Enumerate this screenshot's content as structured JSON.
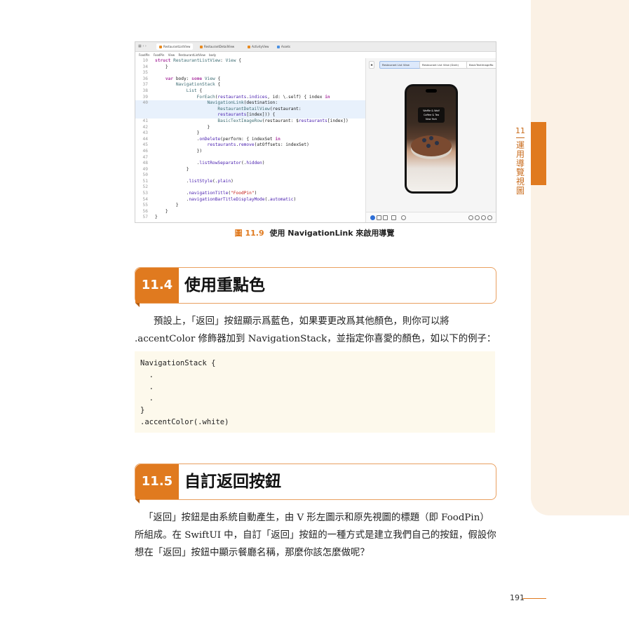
{
  "chapter": {
    "number": "11",
    "title": "運用導覽視圖"
  },
  "screenshot": {
    "tabs": [
      "RestaurantListView",
      "RestaurantDetailView",
      "ActivityView",
      "Assets"
    ],
    "breadcrumbs": [
      "FoodPin",
      "FoodPin",
      "View",
      "RestaurantListView",
      "body"
    ],
    "code_lines": [
      {
        "n": "10",
        "text": "struct RestaurantListView: View {",
        "hl": false
      },
      {
        "n": "34",
        "text": "    }",
        "hl": false
      },
      {
        "n": "35",
        "text": "",
        "hl": false
      },
      {
        "n": "36",
        "text": "    var body: some View {",
        "hl": false
      },
      {
        "n": "37",
        "text": "        NavigationStack {",
        "hl": false
      },
      {
        "n": "38",
        "text": "            List {",
        "hl": false
      },
      {
        "n": "39",
        "text": "                ForEach(restaurants.indices, id: \\.self) { index in",
        "hl": false
      },
      {
        "n": "40",
        "text": "                    NavigationLink(destination:",
        "hl": true
      },
      {
        "n": "",
        "text": "                        RestaurantDetailView(restaurant:",
        "hl": true
      },
      {
        "n": "",
        "text": "                        restaurants[index])) {",
        "hl": true
      },
      {
        "n": "41",
        "text": "                        BasicTextImageRow(restaurant: $restaurants[index])",
        "hl": false
      },
      {
        "n": "42",
        "text": "                    }",
        "hl": false
      },
      {
        "n": "43",
        "text": "                }",
        "hl": false
      },
      {
        "n": "44",
        "text": "                .onDelete(perform: { indexSet in",
        "hl": false
      },
      {
        "n": "45",
        "text": "                    restaurants.remove(atOffsets: indexSet)",
        "hl": false
      },
      {
        "n": "46",
        "text": "                })",
        "hl": false
      },
      {
        "n": "47",
        "text": "",
        "hl": false
      },
      {
        "n": "48",
        "text": "                .listRowSeparator(.hidden)",
        "hl": false
      },
      {
        "n": "49",
        "text": "            }",
        "hl": false
      },
      {
        "n": "50",
        "text": "",
        "hl": false
      },
      {
        "n": "51",
        "text": "            .listStyle(.plain)",
        "hl": false
      },
      {
        "n": "52",
        "text": "",
        "hl": false
      },
      {
        "n": "53",
        "text": "            .navigationTitle(\"FoodPin\")",
        "hl": false
      },
      {
        "n": "54",
        "text": "            .navigationBarTitleDisplayMode(.automatic)",
        "hl": false
      },
      {
        "n": "55",
        "text": "        }",
        "hl": false
      },
      {
        "n": "56",
        "text": "    }",
        "hl": false
      },
      {
        "n": "57",
        "text": "}",
        "hl": false
      }
    ],
    "preview_tabs": [
      "Restaurant List View",
      "Restaurant List View (Dark)",
      "BasicTextImageRo"
    ],
    "phone_popup": [
      "Waffle & Wolf",
      "Coffee & Tea",
      "New York"
    ]
  },
  "figure": {
    "label": "圖 11.9",
    "caption": "使用 NavigationLink 來啟用導覽"
  },
  "section1": {
    "number": "11.4",
    "title": "使用重點色"
  },
  "para1": "預設上，「返回」按鈕顯示爲藍色，如果要更改爲其他顏色，則你可以將 .accentColor 修飾器加到 NavigationStack，並指定你喜愛的顏色，如以下的例子：",
  "code": [
    "NavigationStack {",
    "  .",
    "  .",
    "  .",
    "}",
    ".accentColor(.white)"
  ],
  "section2": {
    "number": "11.5",
    "title": "自訂返回按鈕"
  },
  "para2": "「返回」按鈕是由系統自動產生，由 V 形左圖示和原先視圖的標題（即 FoodPin）所組成。在 SwiftUI 中，自訂「返回」按鈕的一種方式是建立我們自己的按鈕，假設你想在「返回」按鈕中顯示餐廳名稱，那麼你該怎麼做呢？",
  "page_number": "191",
  "colors": {
    "accent": "#e07a1f",
    "tab_bg": "#fbf1e5",
    "code_bg": "#fdf9ec"
  }
}
